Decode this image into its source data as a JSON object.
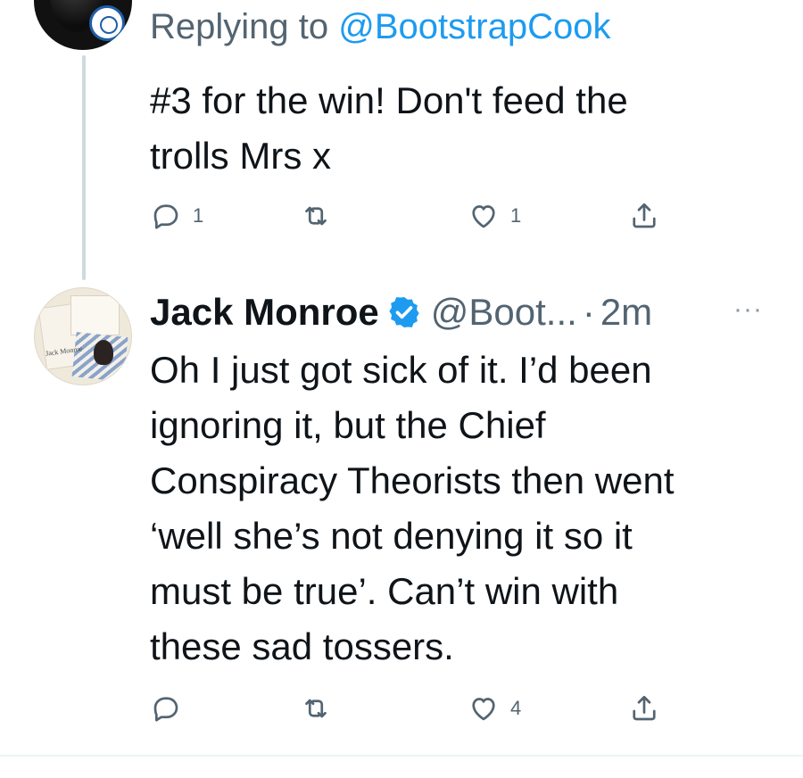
{
  "reply_tweet": {
    "replying_prefix": "Replying to",
    "replying_to": "@BootstrapCook",
    "text_lines": [
      "#3 for the win! Don't feed the",
      "trolls Mrs x"
    ],
    "actions": {
      "reply_count": "1",
      "retweet_count": "",
      "like_count": "1"
    }
  },
  "main_tweet": {
    "display_name": "Jack Monroe",
    "handle": "@Boot...",
    "separator": "·",
    "time": "2m",
    "more": "···",
    "avatar_caption": "Jack Monroe",
    "text_lines": [
      "Oh I just got sick of it. I’d been",
      "ignoring it, but the Chief",
      "Conspiracy Theorists then went",
      "‘well she’s not denying it so it",
      "must be true’. Can’t win with",
      "these sad tossers."
    ],
    "actions": {
      "reply_count": "",
      "retweet_count": "",
      "like_count": "4"
    }
  },
  "icons": {
    "reply": "reply-icon",
    "retweet": "retweet-icon",
    "like": "heart-icon",
    "share": "share-icon",
    "verified": "verified-badge-icon"
  },
  "colors": {
    "text": "#0f1419",
    "secondary": "#536471",
    "accent": "#1d9bf0",
    "thread_line": "#cfd9de"
  }
}
